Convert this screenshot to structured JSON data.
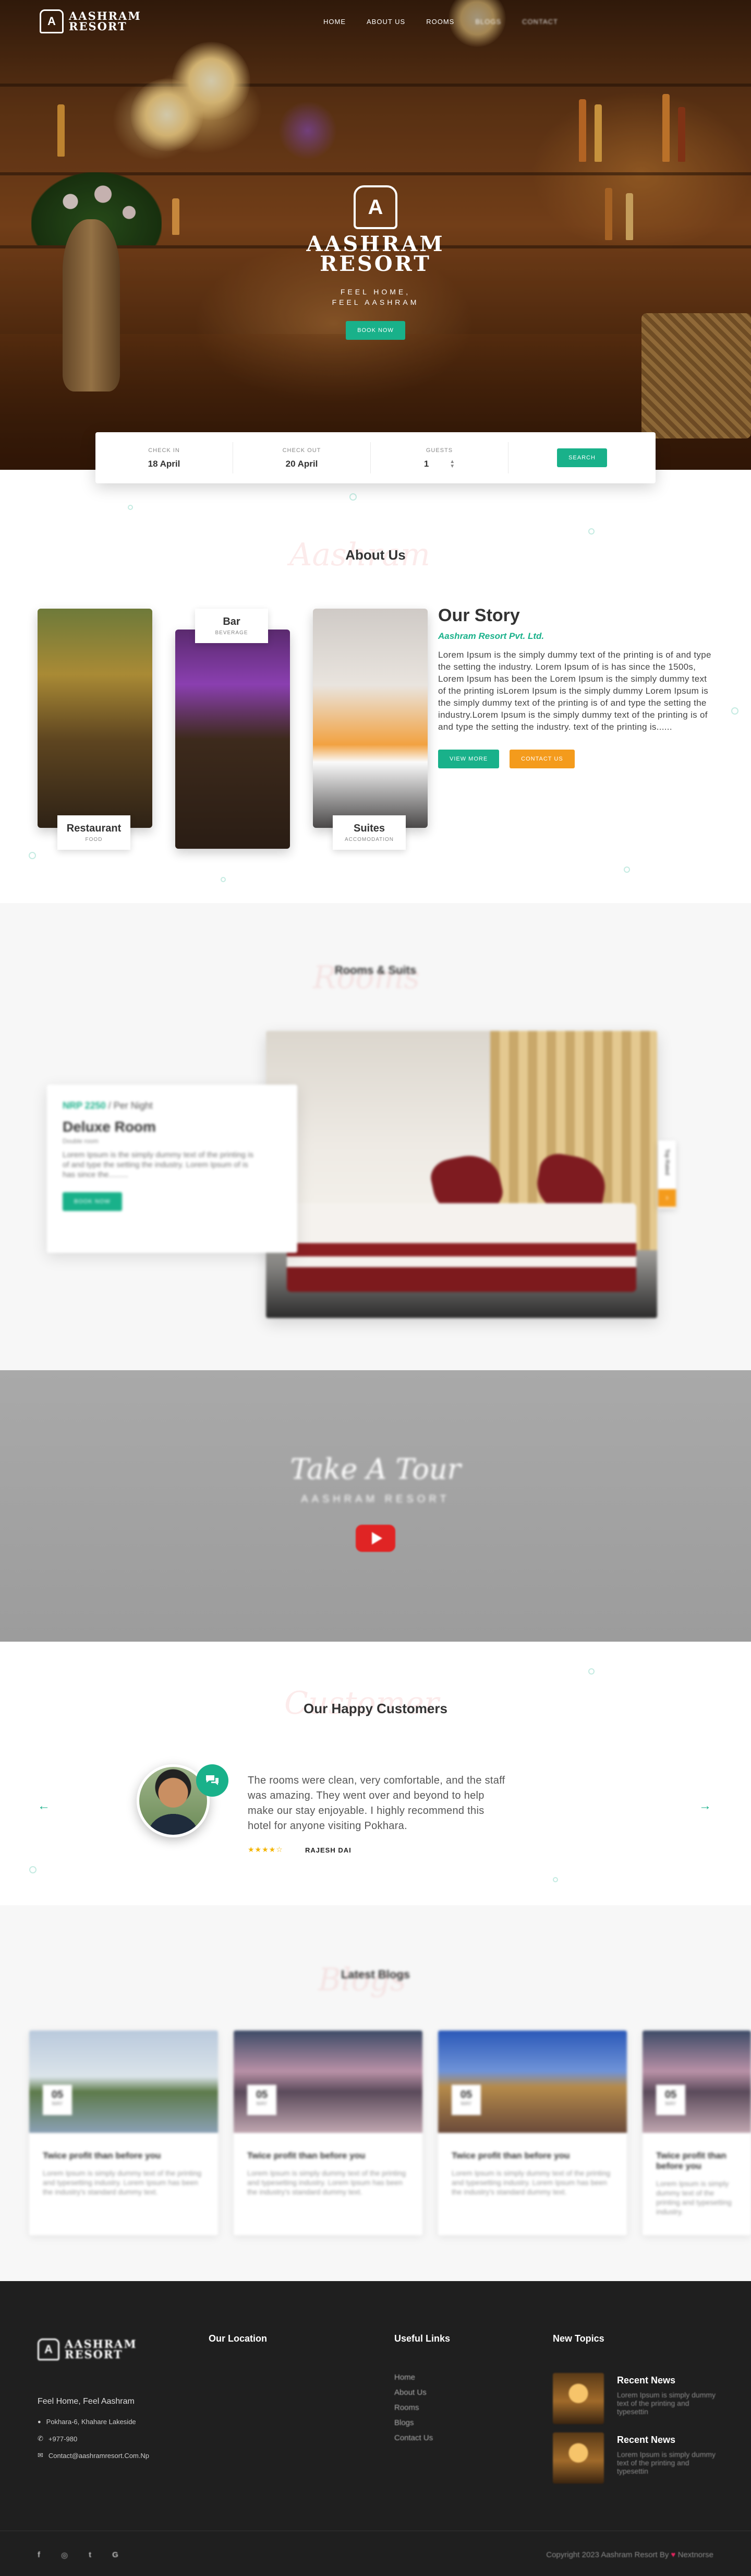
{
  "brand": {
    "name_line1": "AASHRAM",
    "name_line2": "RESORT",
    "mark": "A"
  },
  "nav": {
    "items": [
      "HOME",
      "ABOUT US",
      "ROOMS",
      "BLOGS",
      "CONTACT"
    ]
  },
  "hero": {
    "tagline_line1": "FEEL HOME,",
    "tagline_line2": "FEEL AASHRAM",
    "cta": "BOOK NOW"
  },
  "booking": {
    "checkin_label": "CHECK IN",
    "checkin_value": "18 April",
    "checkout_label": "CHECK OUT",
    "checkout_value": "20 April",
    "guests_label": "GUESTS",
    "guests_value": "1",
    "search": "SEARCH"
  },
  "about": {
    "watermark": "Aashram",
    "title": "About Us",
    "cards": [
      {
        "title": "Restaurant",
        "subtitle": "FOOD"
      },
      {
        "title": "Bar",
        "subtitle": "BEVERAGE"
      },
      {
        "title": "Suites",
        "subtitle": "ACCOMODATION"
      }
    ],
    "story_title": "Our Story",
    "story_company": "Aashram Resort Pvt. Ltd.",
    "story_text": "Lorem Ipsum is the simply dummy text of the printing is of and type the setting the industry. Lorem Ipsum of is has since the 1500s, Lorem Ipsum has been the Lorem Ipsum is the simply dummy text of the printing isLorem Ipsum is the simply dummy Lorem Ipsum is the simply dummy text of the printing is of and type the setting the industry.Lorem Ipsum is the simply dummy text of the printing is of and type the setting the industry. text of the printing is......",
    "view_more": "VIEW MORE",
    "contact_us": "CONTACT US"
  },
  "rooms": {
    "watermark": "Rooms",
    "title": "Rooms & Suits",
    "price": "NRP 2250",
    "per_night": " / Per Night",
    "name": "Deluxe Room",
    "type": "Double room",
    "text": "Lorem Ipsum is the simply dummy text of the printing is of and type the setting the industry. Lorem Ipsum of is has since the.........",
    "cta": "BOOK NOW",
    "side_tab": "Top Rated"
  },
  "tour": {
    "title": "Take A Tour",
    "subtitle": "AASHRAM RESORT"
  },
  "testimonials": {
    "watermark": "Customer",
    "title": "Our Happy Customers",
    "text": "The rooms were clean, very comfortable, and the staff was amazing. They went over and beyond to help make our stay enjoyable. I highly recommend this hotel for anyone visiting Pokhara.",
    "stars": "★★★★☆",
    "name": "RAJESH DAI"
  },
  "blogs": {
    "watermark": "Blogs",
    "title": "Latest Blogs",
    "posts": [
      {
        "day": "05",
        "month": "MAY",
        "title": "Twice profit than before you",
        "text": "Lorem Ipsum is simply dummy text of the printing and typesetting industry. Lorem Ipsum has been the industry's standard dummy text."
      },
      {
        "day": "05",
        "month": "MAY",
        "title": "Twice profit than before you",
        "text": "Lorem Ipsum is simply dummy text of the printing and typesetting industry. Lorem Ipsum has been the industry's standard dummy text."
      },
      {
        "day": "05",
        "month": "MAY",
        "title": "Twice profit than before you",
        "text": "Lorem Ipsum is simply dummy text of the printing and typesetting industry. Lorem Ipsum has been the industry's standard dummy text."
      },
      {
        "day": "05",
        "month": "MAY",
        "title": "Twice profit than before you",
        "text": "Lorem Ipsum is simply dummy text of the printing and typesetting industry."
      }
    ]
  },
  "footer": {
    "tagline": "Feel Home, Feel Aashram",
    "address": "Pokhara-6, Khahare Lakeside",
    "phone": "+977-980",
    "email": "Contact@aashramresort.Com.Np",
    "location_heading": "Our Location",
    "links_heading": "Useful Links",
    "links": [
      "Home",
      "About Us",
      "Rooms",
      "Blogs",
      "Contact Us"
    ],
    "news_heading": "New Topics",
    "news": [
      {
        "title": "Recent News",
        "text": "Lorem Ipsum is simply dummy text of the printing and typesettin"
      },
      {
        "title": "Recent News",
        "text": "Lorem Ipsum is simply dummy text of the printing and typesettin"
      }
    ],
    "social": [
      "f",
      "◎",
      "t",
      "G"
    ],
    "copyright": "Copyright 2023 Aashram Resort By",
    "heart": "♥",
    "credit": "Nextnorse"
  },
  "colors": {
    "accent": "#19b18a",
    "orange": "#f49b1c",
    "footer_bg": "#1f1f1f",
    "play_red": "#e02424"
  },
  "icons": {
    "pin": "📍",
    "phone": "✆",
    "mail": "✉",
    "quote": "chat-bubble-icon",
    "arrow_left": "←",
    "arrow_right": "→",
    "updown": "⌃⌄"
  }
}
